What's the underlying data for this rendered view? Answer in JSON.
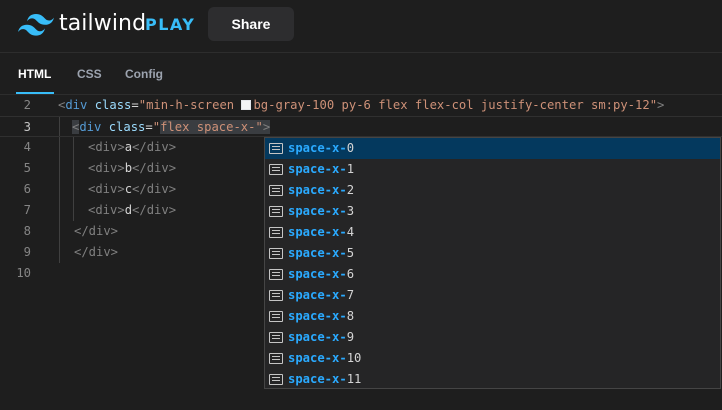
{
  "header": {
    "brand": "tailwind",
    "brand_play": "PLAY",
    "share_label": "Share"
  },
  "tabs": [
    {
      "label": "HTML"
    },
    {
      "label": "CSS"
    },
    {
      "label": "Config"
    }
  ],
  "editor": {
    "lines": [
      {
        "num": "2"
      },
      {
        "num": "3"
      },
      {
        "num": "4"
      },
      {
        "num": "5"
      },
      {
        "num": "6"
      },
      {
        "num": "7"
      },
      {
        "num": "8"
      },
      {
        "num": "9"
      },
      {
        "num": "10"
      }
    ],
    "line2": {
      "open": "<",
      "tag": "div",
      "attr": "class",
      "eq": "=",
      "str_a": "\"min-h-screen ",
      "str_b": "bg-gray-100 py-6 flex flex-col justify-center sm:py-12\"",
      "close": ">"
    },
    "line3": {
      "open": "<",
      "tag": "div",
      "attr": "class",
      "eq": "=",
      "quote": "\"",
      "str": "flex space-x-\"",
      "close": ">"
    },
    "children": [
      {
        "text": "a"
      },
      {
        "text": "b"
      },
      {
        "text": "c"
      },
      {
        "text": "d"
      }
    ],
    "tag_open": "<div>",
    "tag_close": "</div>",
    "closing_tag": "</div>"
  },
  "suggestions": {
    "prefix": "space-x-",
    "items": [
      {
        "suffix": "0"
      },
      {
        "suffix": "1"
      },
      {
        "suffix": "2"
      },
      {
        "suffix": "3"
      },
      {
        "suffix": "4"
      },
      {
        "suffix": "5"
      },
      {
        "suffix": "6"
      },
      {
        "suffix": "7"
      },
      {
        "suffix": "8"
      },
      {
        "suffix": "9"
      },
      {
        "suffix": "10"
      },
      {
        "suffix": "11"
      }
    ],
    "selected_index": 0,
    "icon": "text-icon"
  },
  "colors": {
    "accent": "#38bdf8",
    "match": "#2aaaff",
    "selected_row": "#04395e",
    "background": "#1e1e1e"
  }
}
